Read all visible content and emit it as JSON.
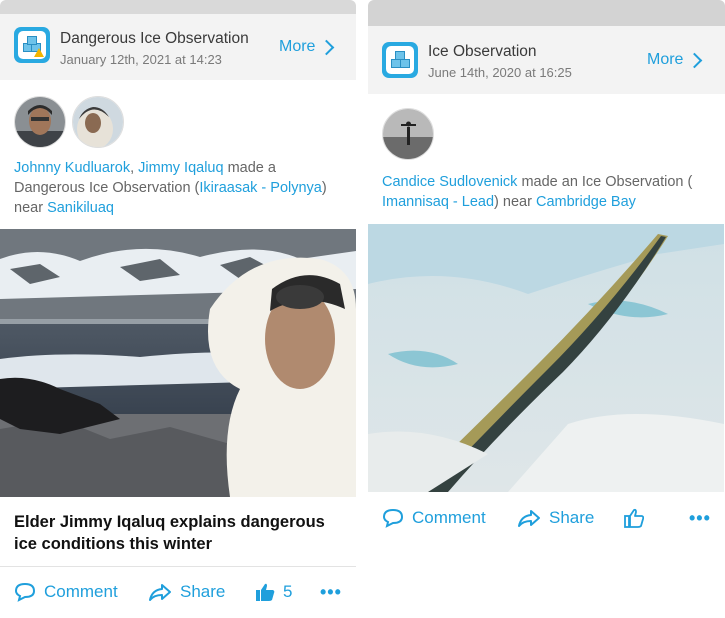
{
  "cards": [
    {
      "title": "Dangerous Ice Observation",
      "date": "January 12th, 2021 at 14:23",
      "more_label": "More",
      "actor_1": "Johnny Kudluarok",
      "sep": ", ",
      "actor_2": "Jimmy Iqaluq",
      "verb": " made a Dangerous Ice Observation (",
      "type_link": "Ikiraasak - Polynya",
      "near": ") near ",
      "place": "Sanikiluaq",
      "caption": "Elder Jimmy Iqaluq explains dangerous ice conditions this winter",
      "comment_label": "Comment",
      "share_label": "Share",
      "like_count": "5",
      "more_dots": "•••"
    },
    {
      "title": "Ice Observation",
      "date": "June 14th, 2020 at 16:25",
      "more_label": "More",
      "actor_1": "Candice Sudlovenick",
      "verb": " made an Ice Observation ( ",
      "type_link": "Imannisaq - Lead",
      "near": ") near ",
      "place": "Cambridge Bay",
      "comment_label": "Comment",
      "share_label": "Share",
      "more_dots": "•••"
    }
  ],
  "colors": {
    "accent": "#1f9fdc",
    "header_bg": "#f3f3f3",
    "icon_bg": "#29a9e1"
  }
}
